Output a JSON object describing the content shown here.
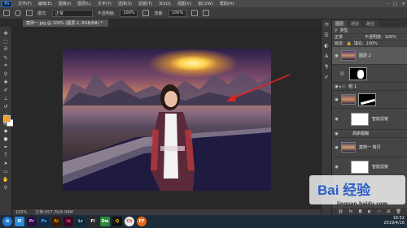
{
  "app": {
    "logo": "Ps"
  },
  "menu": [
    "文件(F)",
    "编辑(E)",
    "图像(I)",
    "图层(L)",
    "文字(Y)",
    "选择(S)",
    "滤镜(T)",
    "3D(D)",
    "视图(V)",
    "窗口(W)",
    "帮助(H)"
  ],
  "window_controls": [
    "–",
    "□",
    "✕"
  ],
  "options": {
    "mode_label": "模式:",
    "mode_value": "正常",
    "opacity_label": "不透明度:",
    "opacity_value": "100%",
    "flow_label": "流量:",
    "flow_value": "100%"
  },
  "document_tab": "案例一.jpg @ 100% (图层 2, RGB/8#) *",
  "status": {
    "zoom": "100%",
    "doc": "文档:957.7K/6.99M"
  },
  "layers_panel": {
    "tabs": [
      "图层",
      "通道",
      "路径"
    ],
    "filter_label": "类型",
    "blend_mode": "正常",
    "opacity_label": "不透明度:",
    "opacity_value": "100%",
    "lock_label": "锁定:",
    "fill_label": "填充:",
    "fill_value": "100%",
    "layers": [
      {
        "name": "图层 2",
        "type": "image",
        "selected": true
      },
      {
        "name": "",
        "type": "mask-black"
      },
      {
        "name": "组 1",
        "type": "group"
      },
      {
        "name": "",
        "type": "mask-white-stroke"
      },
      {
        "name": "智能滤镜",
        "type": "mask"
      },
      {
        "name": "高斯模糊",
        "type": "filter"
      },
      {
        "name": "案例一 拷贝",
        "type": "image"
      },
      {
        "name": "智能滤镜",
        "type": "mask"
      }
    ],
    "bottom_icons": [
      "link-icon",
      "fx-icon",
      "mask-icon",
      "adjust-icon",
      "folder-icon",
      "new-icon",
      "trash-icon"
    ]
  },
  "watermark": {
    "text": "Bai 经验",
    "url": "jingyan.baidu.com"
  },
  "taskbar": {
    "apps": [
      "IE",
      "Pr",
      "Ps",
      "Ai",
      "Id",
      "Lr",
      "Fl",
      "Dw",
      "Q",
      "Ch",
      "FF"
    ],
    "time": "19:52",
    "date": "2019/4/16"
  },
  "colors": {
    "foreground": "#f0a020",
    "background": "#ffffff",
    "arrow": "#e0221e"
  }
}
